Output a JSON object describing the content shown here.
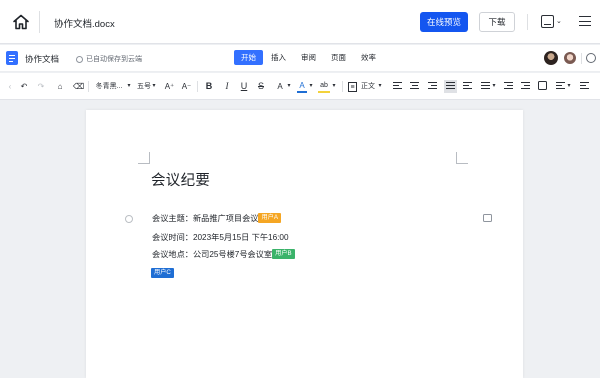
{
  "topbar": {
    "filename": "协作文档.docx",
    "preview_label": "在线预览",
    "download_label": "下载"
  },
  "docbar": {
    "title": "协作文档",
    "save_status": "已自动保存到云端",
    "tabs": [
      {
        "label": "开始",
        "active": true
      },
      {
        "label": "插入",
        "active": false
      },
      {
        "label": "审阅",
        "active": false
      },
      {
        "label": "页面",
        "active": false
      },
      {
        "label": "效率",
        "active": false
      }
    ]
  },
  "toolbar": {
    "font_family": "冬青黑...",
    "font_size": "五号",
    "grow_font": "A⁺",
    "shrink_font": "A⁻",
    "bold": "B",
    "italic": "I",
    "underline": "U",
    "strike": "S",
    "superscript": "A",
    "font_color": "A",
    "highlight": "ab",
    "style_label": "正文"
  },
  "document": {
    "heading": "会议纪要",
    "lines": [
      {
        "text": "会议主题：新品推广项目会议",
        "tag": "用户A"
      },
      {
        "text": "会议时间：2023年5月15日 下午16:00",
        "tag": ""
      },
      {
        "text": "会议地点：公司25号楼7号会议室",
        "tag": "用户B"
      }
    ],
    "standalone_tag": "用户C"
  },
  "colors": {
    "accent": "#1456f0",
    "tab_active": "#3370ff",
    "tag_a": "#f5a623",
    "tag_b": "#3bb36a",
    "tag_c": "#1f6ed4"
  }
}
